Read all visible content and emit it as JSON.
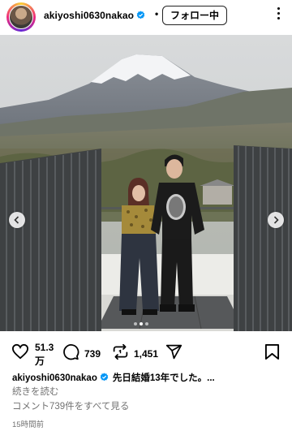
{
  "header": {
    "username": "akiyoshi0630nakao",
    "separator": "•",
    "follow_label": "フォロー中"
  },
  "post": {
    "carousel_dots": 3,
    "active_dot": 2
  },
  "actions": {
    "likes": "51.3",
    "likes_unit": "万",
    "comments": "739",
    "reposts": "1,451"
  },
  "caption": {
    "username": "akiyoshi0630nakao",
    "text": "先日結婚13年でした。..."
  },
  "read_more": "続きを読む",
  "view_comments": "コメント739件をすべて見る",
  "timestamp": "15時間前",
  "colors": {
    "verified": "#0095f6",
    "muted_text": "#737373"
  },
  "icons": {
    "like": "heart-icon",
    "comment": "comment-icon",
    "repost": "repost-icon",
    "share": "share-icon",
    "save": "bookmark-icon",
    "more": "more-icon"
  }
}
